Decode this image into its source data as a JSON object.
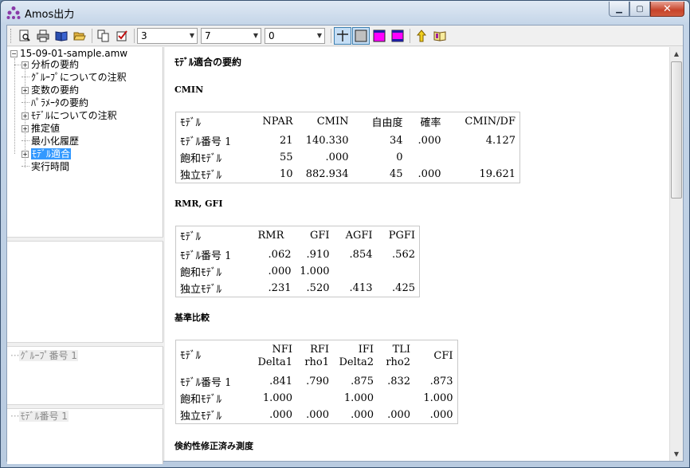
{
  "window": {
    "title": "Amos出力"
  },
  "toolbar": {
    "combos": [
      {
        "value": "3"
      },
      {
        "value": "7"
      },
      {
        "value": "0"
      }
    ]
  },
  "tree": {
    "root": "15-09-01-sample.amw",
    "items": [
      {
        "label": "分析の要約",
        "expandable": true
      },
      {
        "label": "ｸﾞﾙｰﾌﾟについての注釈",
        "expandable": false
      },
      {
        "label": "変数の要約",
        "expandable": true
      },
      {
        "label": "ﾊﾟﾗﾒｰﾀの要約",
        "expandable": false
      },
      {
        "label": "ﾓﾃﾞﾙについての注釈",
        "expandable": true
      },
      {
        "label": "推定値",
        "expandable": true
      },
      {
        "label": "最小化履歴",
        "expandable": false
      },
      {
        "label": "ﾓﾃﾞﾙ適合",
        "expandable": true,
        "selected": true
      },
      {
        "label": "実行時間",
        "expandable": false
      }
    ]
  },
  "groups": {
    "group_label": "ｸﾞﾙｰﾌﾟ番号 1",
    "model_label": "ﾓﾃﾞﾙ番号 1"
  },
  "report": {
    "title": "ﾓﾃﾞﾙ適合の要約",
    "cmin": {
      "heading": "CMIN",
      "headers": [
        "ﾓﾃﾞﾙ",
        "NPAR",
        "CMIN",
        "自由度",
        "確率",
        "CMIN/DF"
      ],
      "rows": [
        [
          "ﾓﾃﾞﾙ番号 1",
          "21",
          "140.330",
          "34",
          ".000",
          "4.127"
        ],
        [
          "飽和ﾓﾃﾞﾙ",
          "55",
          ".000",
          "0",
          "",
          ""
        ],
        [
          "独立ﾓﾃﾞﾙ",
          "10",
          "882.934",
          "45",
          ".000",
          "19.621"
        ]
      ]
    },
    "rmr": {
      "heading": "RMR, GFI",
      "headers": [
        "ﾓﾃﾞﾙ",
        "RMR",
        "GFI",
        "AGFI",
        "PGFI"
      ],
      "rows": [
        [
          "ﾓﾃﾞﾙ番号 1",
          ".062",
          ".910",
          ".854",
          ".562"
        ],
        [
          "飽和ﾓﾃﾞﾙ",
          ".000",
          "1.000",
          "",
          ""
        ],
        [
          "独立ﾓﾃﾞﾙ",
          ".231",
          ".520",
          ".413",
          ".425"
        ]
      ]
    },
    "baseline": {
      "heading": "基準比較",
      "headers": [
        {
          "l1": "ﾓﾃﾞﾙ",
          "l2": ""
        },
        {
          "l1": "NFI",
          "l2": "Delta1"
        },
        {
          "l1": "RFI",
          "l2": "rho1"
        },
        {
          "l1": "IFI",
          "l2": "Delta2"
        },
        {
          "l1": "TLI",
          "l2": "rho2"
        },
        {
          "l1": "CFI",
          "l2": ""
        }
      ],
      "rows": [
        [
          "ﾓﾃﾞﾙ番号 1",
          ".841",
          ".790",
          ".875",
          ".832",
          ".873"
        ],
        [
          "飽和ﾓﾃﾞﾙ",
          "1.000",
          "",
          "1.000",
          "",
          "1.000"
        ],
        [
          "独立ﾓﾃﾞﾙ",
          ".000",
          ".000",
          ".000",
          ".000",
          ".000"
        ]
      ]
    },
    "parsimony": {
      "heading": "倹約性修正済み測度"
    }
  }
}
